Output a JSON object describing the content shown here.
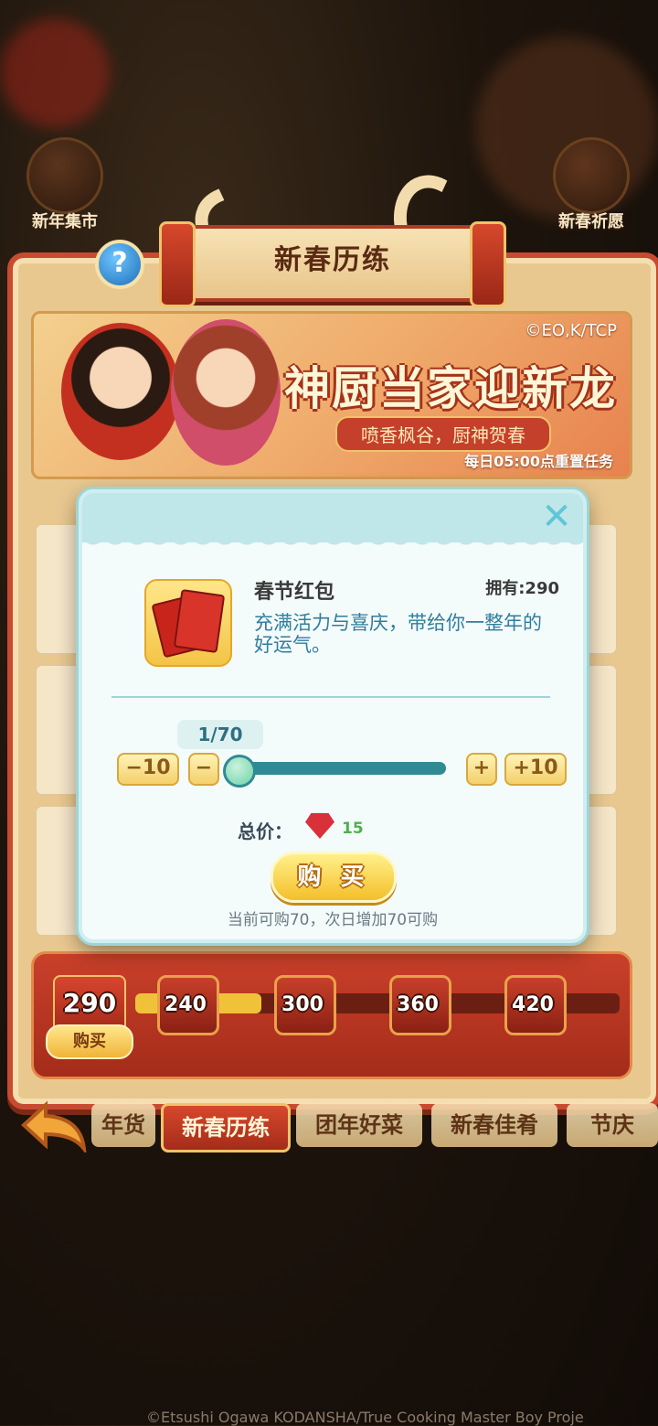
{
  "corner": {
    "left_label": "新年集市",
    "right_label": "新春祈愿"
  },
  "header": {
    "title": "新春历练",
    "help_symbol": "?"
  },
  "banner": {
    "copyright": "©EO,K/TCP",
    "headline": "神厨当家迎新龙",
    "subline": "喷香枫谷，厨神贺春",
    "reset_note": "每日05:00点重置任务"
  },
  "progress": {
    "current_count": "290",
    "buy_label": "购买",
    "milestones": [
      "240",
      "300",
      "360",
      "420"
    ]
  },
  "tabs": {
    "items": [
      "年货",
      "新春历练",
      "团年好菜",
      "新春佳肴",
      "节庆"
    ],
    "active": "新春历练"
  },
  "dialog": {
    "close_symbol": "✕",
    "item_name": "春节红包",
    "owned": "拥有:290",
    "description": "充满活力与喜庆，带给你一整年的好运气。",
    "quantity": "1/70",
    "minus10": "−10",
    "minus1": "−",
    "plus1": "+",
    "plus10": "+10",
    "price_label": "总价：",
    "price_value": "15",
    "buy_button": "购 买",
    "note": "当前可购70，次日增加70可购"
  },
  "footer": {
    "copyright": "©Etsushi Ogawa KODANSHA/True Cooking Master Boy Proje"
  },
  "colors": {
    "accent_red": "#c84a30",
    "dialog_bg": "#f4fbfb",
    "teal": "#2f8a94",
    "gold": "#f4bf2a"
  }
}
